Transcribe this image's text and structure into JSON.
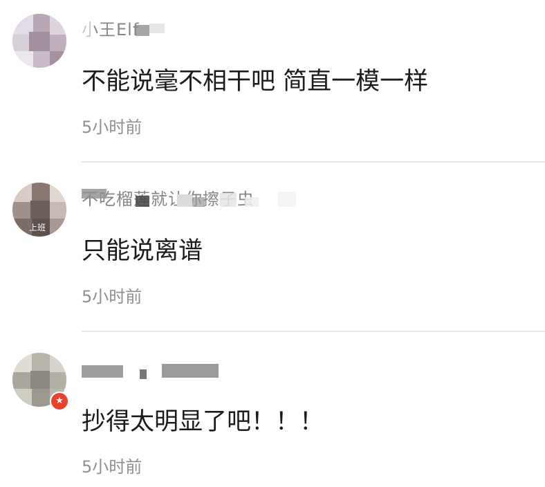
{
  "comments": [
    {
      "username": "小王Elf",
      "text": "不能说毫不相干吧 简直一模一样",
      "time": "5小时前"
    },
    {
      "username": "不吃榴莲就让你擦子虫",
      "avatar_label": "上班",
      "text": "只能说离谱",
      "time": "5小时前"
    },
    {
      "username": "",
      "text": "抄得太明显了吧！！！",
      "time": "5小时前"
    }
  ],
  "colors": {
    "text": "#1b1b1b",
    "time": "#8f8f8f",
    "divider": "#e6e6e6",
    "badge": "#e8412d"
  }
}
